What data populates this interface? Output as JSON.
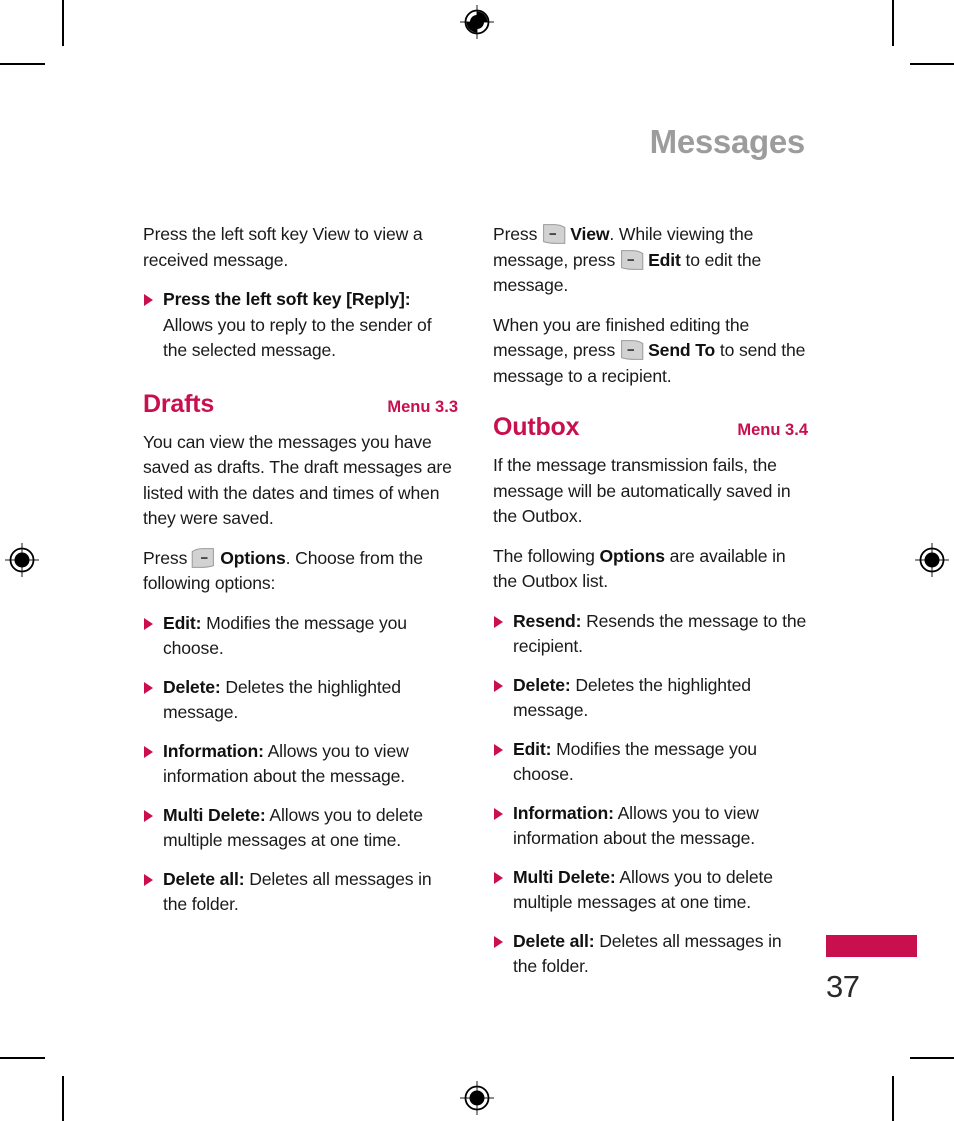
{
  "document": {
    "chapter_title": "Messages",
    "page_number": "37"
  },
  "icons": {
    "softkey_left": "left-soft-key-icon",
    "softkey_right": "right-soft-key-icon",
    "bullet": "triangle-bullet-icon",
    "registration": "registration-mark-icon"
  },
  "colors": {
    "accent": "#c8104e",
    "chapter_title": "#9c9c9c",
    "body_text": "#1a1a1a",
    "softkey_fill": "#d2d2d2"
  },
  "left_column": {
    "intro_paragraph": "Press the left soft key View to view a received message.",
    "intro_bullets": [
      {
        "term": "Press the left soft key [Reply]:",
        "description": " Allows you to reply to the sender of the selected message."
      }
    ],
    "section": {
      "title": "Drafts",
      "menu": "Menu 3.3",
      "paragraph_1": "You can view the messages you have saved as drafts. The draft messages are listed with the dates and times of when they were saved.",
      "press_line": {
        "prefix": "Press",
        "key_label": "Options",
        "suffix": ". Choose from the following options:"
      },
      "bullets": [
        {
          "term": "Edit:",
          "description": " Modifies the message you choose."
        },
        {
          "term": "Delete:",
          "description": " Deletes the highlighted message."
        },
        {
          "term": "Information:",
          "description": " Allows you to view information about the message."
        },
        {
          "term": "Multi Delete:",
          "description": " Allows you to delete multiple messages at one time."
        },
        {
          "term": "Delete all:",
          "description": " Deletes all messages in the folder."
        }
      ]
    }
  },
  "right_column": {
    "intro": {
      "part_1": "Press",
      "key_label_1": "View",
      "part_2": ". While viewing the message, press",
      "key_label_2": "Edit",
      "part_3": " to edit the message."
    },
    "intro_2": {
      "part_1": "When you are finished editing the message, press",
      "key_label_1": "Send To",
      "part_2": " to send the message to a recipient."
    },
    "section": {
      "title": "Outbox",
      "menu": "Menu 3.4",
      "paragraph_1": "If the message transmission fails, the message will be automatically saved in the Outbox.",
      "paragraph_2": {
        "prefix": "The following ",
        "bold": "Options",
        "suffix": " are available in the Outbox list."
      },
      "bullets": [
        {
          "term": "Resend:",
          "description": " Resends the message to the recipient."
        },
        {
          "term": "Delete:",
          "description": " Deletes the highlighted message."
        },
        {
          "term": "Edit:",
          "description": " Modifies the message you choose."
        },
        {
          "term": "Information:",
          "description": " Allows you to view information about the message."
        },
        {
          "term": "Multi Delete:",
          "description": " Allows you to delete multiple messages at one time."
        },
        {
          "term": "Delete all:",
          "description": " Deletes all messages in the folder."
        }
      ]
    }
  }
}
